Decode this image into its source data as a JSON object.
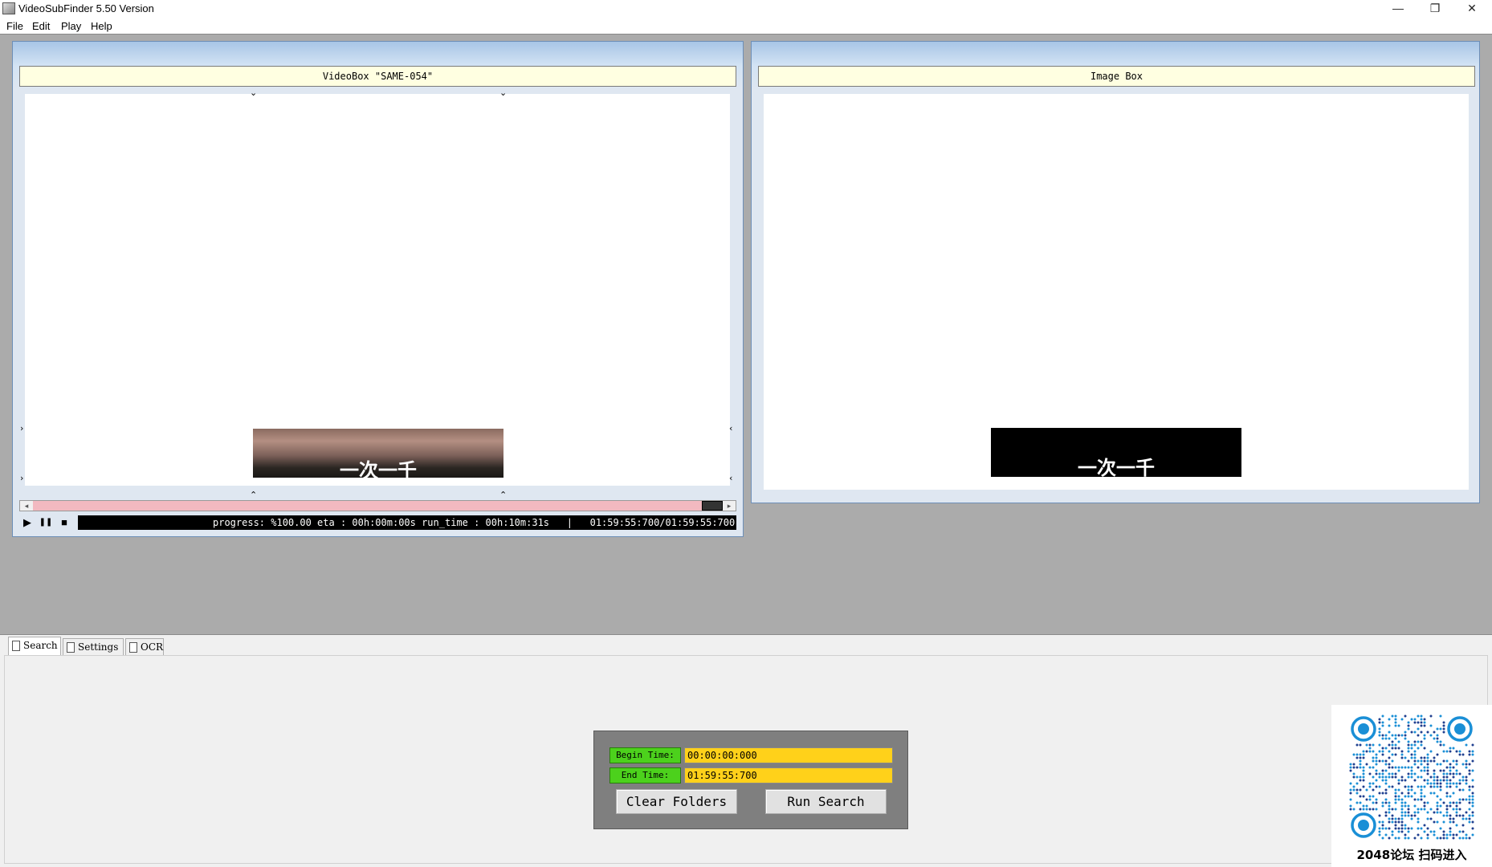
{
  "window": {
    "title": "VideoSubFinder 5.50 Version",
    "minimize_glyph": "—",
    "restore_glyph": "❐",
    "close_glyph": "✕"
  },
  "menu": [
    "File",
    "Edit",
    "Play",
    "Help"
  ],
  "video_box": {
    "header": "VideoBox \"SAME-054\"",
    "subtitle_text": "一次一千",
    "progress_text": "progress: %100.00 eta : 00h:00m:00s run_time : 00h:10m:31s   |   01:59:55:700/01:59:55:700",
    "scroll_left": "◂",
    "scroll_right": "▸",
    "play_glyph": "▶",
    "pause_glyph": "❚❚",
    "stop_glyph": "■",
    "marker_down": "⌄",
    "marker_up": "⌃",
    "marker_right": "›",
    "marker_left": "‹",
    "scrollbar_color": "#f2b9c0",
    "position_fraction": 1.0
  },
  "image_box": {
    "header": "Image Box",
    "subtitle_text": "一次一千"
  },
  "tabs": [
    "Search",
    "Settings",
    "OCR"
  ],
  "search": {
    "begin_label": "Begin Time:",
    "begin_value": "00:00:00:000",
    "end_label": "End Time:",
    "end_value": "01:59:55:700",
    "clear_button": "Clear Folders",
    "run_button": "Run Search",
    "label_color": "#4cd11c",
    "input_color": "#ffd11a"
  },
  "watermark": {
    "caption": "2048论坛 扫码进入",
    "icon": "qr-code-icon",
    "color": "#1a8fd6"
  }
}
